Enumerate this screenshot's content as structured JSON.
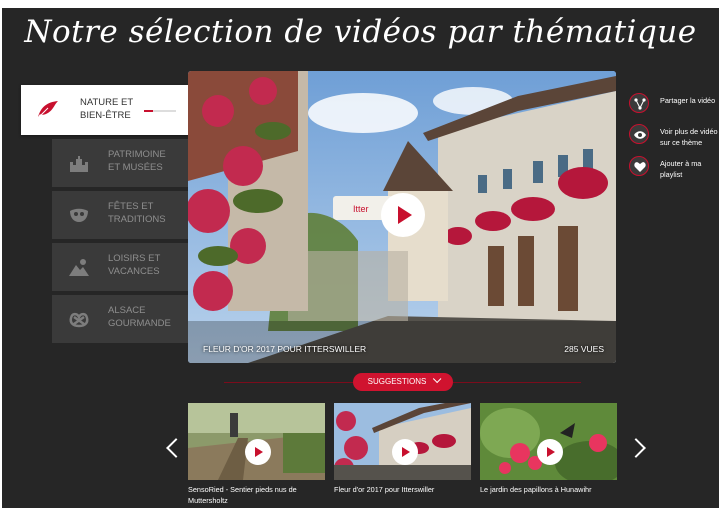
{
  "title": "Notre sélection de vidéos par thématique",
  "categories": [
    {
      "label_line1": "NATURE ET",
      "label_line2": "BIEN-ÊTRE",
      "icon": "leaf-icon",
      "active": true
    },
    {
      "label_line1": "PATRIMOINE",
      "label_line2": "ET MUSÉES",
      "icon": "castle-icon",
      "active": false
    },
    {
      "label_line1": "FÊTES ET",
      "label_line2": "TRADITIONS",
      "icon": "mask-icon",
      "active": false
    },
    {
      "label_line1": "LOISIRS ET",
      "label_line2": "VACANCES",
      "icon": "mountain-sun-icon",
      "active": false
    },
    {
      "label_line1": "ALSACE",
      "label_line2": "GOURMANDE",
      "icon": "pretzel-icon",
      "active": false
    }
  ],
  "video": {
    "caption": "FLEUR D'OR 2017 POUR ITTERSWILLER",
    "views": "285 VUES"
  },
  "actions": [
    {
      "line1": "Partager la vidéo",
      "line2": "",
      "icon": "share-icon"
    },
    {
      "line1": "Voir plus de vidéo",
      "line2": "sur ce thème",
      "icon": "eye-icon"
    },
    {
      "line1": "Ajouter à ma",
      "line2": "playlist",
      "icon": "heart-icon"
    }
  ],
  "suggestions": {
    "label": "SUGGESTIONS",
    "items": [
      {
        "line1": "SensoRied - Sentier pieds nus de",
        "line2": "Muttersholtz"
      },
      {
        "line1": "Fleur d'or 2017 pour Itterswiller",
        "line2": ""
      },
      {
        "line1": "Le jardin des papillons à Hunawihr",
        "line2": ""
      }
    ]
  },
  "colors": {
    "accent": "#c8102e",
    "panel": "#262626",
    "tile": "#3a3a3a"
  }
}
